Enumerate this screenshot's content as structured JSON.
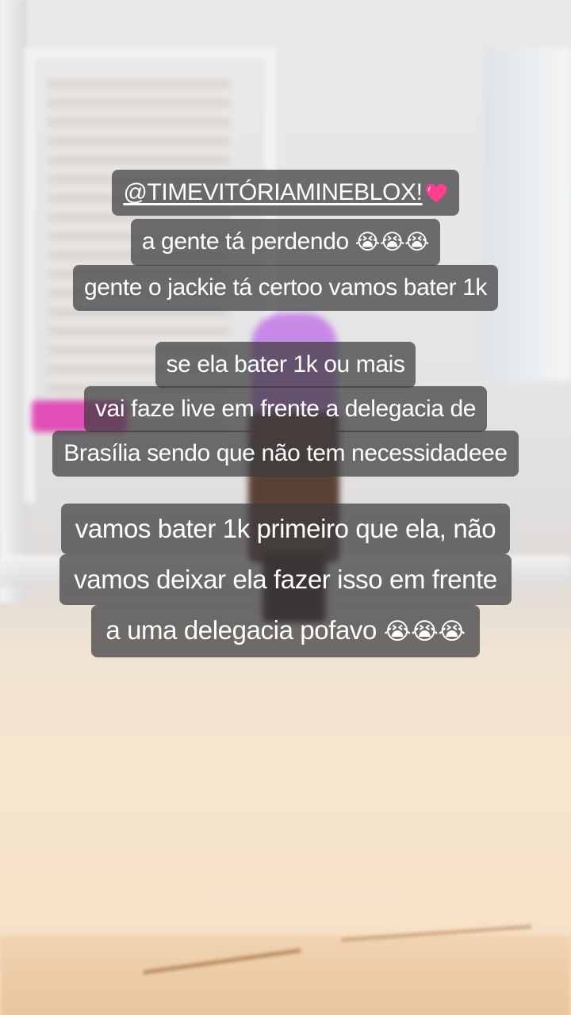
{
  "caption_block_1": {
    "handle": "@TIMEVITÓRIAMINEBLOX!",
    "heart_icon": "pink-heart",
    "line_2": "a gente tá perdendo",
    "line_2_emojis": "😭😭😭",
    "line_3": "gente o jackie tá certoo vamos bater 1k"
  },
  "caption_block_2": {
    "line_1": "se ela bater 1k ou mais",
    "line_2": "vai faze live em frente a delegacia de",
    "line_3": "Brasília sendo que não tem necessidadeee"
  },
  "caption_block_3": {
    "line_1": "vamos bater 1k primeiro que ela, não",
    "line_2": "vamos deixar ela fazer isso em frente",
    "line_3": "a uma delegacia pofavo",
    "line_3_emojis": "😭😭😭"
  },
  "colors": {
    "caption_background": "#3c3c3e",
    "caption_text": "#ffffff",
    "heart": "#ff3f8e"
  }
}
